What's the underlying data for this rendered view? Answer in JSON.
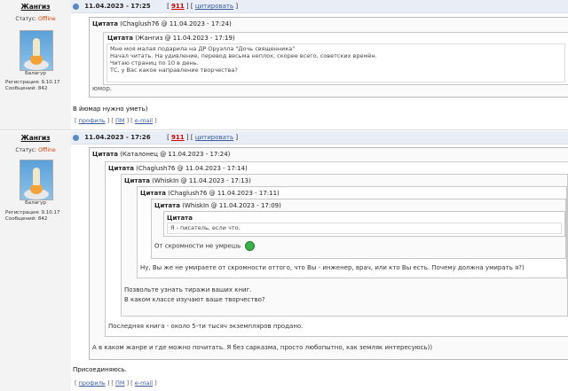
{
  "post1": {
    "author": "Жангиз",
    "status_label": "Статус:",
    "status_value": "Offline",
    "nickname": "Балагур",
    "reg_line": "Регистрация: 9.10.17",
    "msgs_line": "Сообщений: 842",
    "date": "11.04.2023 - 17:25",
    "num": "911",
    "quote_link": "цитировать",
    "bracket_open": "[",
    "bracket_mid": "] [",
    "bracket_close": "]",
    "q1_title": "Цитата",
    "q1_meta": "(Chaglush76 @ 11.04.2023 - 17:24)",
    "q2_title": "Цитата",
    "q2_meta": "(Жангиз @ 11.04.2023 - 17:19)",
    "q2_lines": [
      "Мне моя малая подарила на ДР Оруэлла \"Дочь священника\"",
      "Начал читать. На удивление, перевод весьма неплох, скорее всего, советских времён.",
      "Читаю страниц по 10 в день.",
      "ТС, у Вас какое направление творчества?"
    ],
    "q1_reply": "юмор.",
    "text": "В йюмар нужно уметь)",
    "footer": [
      "профиль",
      "ПМ",
      "e-mail"
    ]
  },
  "post2": {
    "author": "Жангиз",
    "status_label": "Статус:",
    "status_value": "Offline",
    "nickname": "Балагур",
    "reg_line": "Регистрация: 9.10.17",
    "msgs_line": "Сообщений: 842",
    "date": "11.04.2023 - 17:26",
    "num": "911",
    "quote_link": "цитировать",
    "bracket_open": "[",
    "bracket_mid": "] [",
    "bracket_close": "]",
    "quotes": [
      {
        "title": "Цитата",
        "meta": "(Каталонец @ 11.04.2023 - 17:24)"
      },
      {
        "title": "Цитата",
        "meta": "(Chaglush76 @ 11.04.2023 - 17:14)"
      },
      {
        "title": "Цитата",
        "meta": "(WhiskIn @ 11.04.2023 - 17:13)"
      },
      {
        "title": "Цитата",
        "meta": "(Chaglush76 @ 11.04.2023 - 17:11)"
      },
      {
        "title": "Цитата",
        "meta": "(WhiskIn @ 11.04.2023 - 17:09)"
      },
      {
        "title": "Цитата",
        "meta": ""
      }
    ],
    "innermost_text": "Я - писатель, если что.",
    "l5_reply": "От скромности не умрешь",
    "l4_reply": "Ну, Вы же не умираете от скромности оттого, что Вы - инженер, врач, или кто Вы есть. Почему должна умирать я?)",
    "l3_reply_1": "Позвольте узнать тиражи ваших книг.",
    "l3_reply_2": "В каком классе изучают ваше творчество?",
    "l2_reply": "Последняя книга - около 5-ти тысяч экземпляров продано.",
    "l1_reply": "А в каком жанре и где можно почитать. Я без сарказма, просто любопытно, как земляк интересуюсь))",
    "text": "Присоединяюсь.",
    "footer": [
      "профиль",
      "ПМ",
      "e-mail"
    ]
  }
}
